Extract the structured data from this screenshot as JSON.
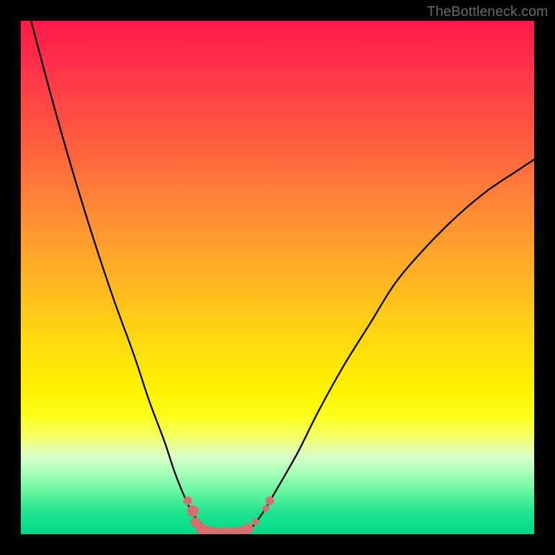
{
  "watermark": "TheBottleneck.com",
  "chart_data": {
    "type": "line",
    "title": "",
    "xlabel": "",
    "ylabel": "",
    "xlim": [
      0,
      100
    ],
    "ylim": [
      0,
      100
    ],
    "series": [
      {
        "name": "left-curve",
        "x": [
          2,
          6,
          10,
          14,
          18,
          22,
          25,
          28,
          30,
          32,
          33.5,
          35,
          36
        ],
        "values": [
          100,
          85,
          71,
          58,
          46,
          35,
          26,
          18,
          12,
          7,
          4,
          2,
          0
        ]
      },
      {
        "name": "right-curve",
        "x": [
          44,
          47,
          50,
          54,
          58,
          63,
          68,
          73,
          79,
          85,
          91,
          97,
          100
        ],
        "values": [
          0,
          4,
          9,
          16,
          24,
          33,
          41,
          49,
          56,
          62,
          67,
          71,
          73
        ]
      }
    ],
    "flat_bottom": {
      "x_start": 36,
      "x_end": 44,
      "value": 0
    },
    "markers": {
      "name": "bottom-dots",
      "color": "#d6706f",
      "points": [
        {
          "x": 32.5,
          "y": 6.5,
          "r": 1.5
        },
        {
          "x": 33.5,
          "y": 4.5,
          "r": 2.0
        },
        {
          "x": 34.0,
          "y": 2.3,
          "r": 1.7
        },
        {
          "x": 35.2,
          "y": 1.0,
          "r": 2.0
        },
        {
          "x": 36.8,
          "y": 0.4,
          "r": 2.0
        },
        {
          "x": 38.4,
          "y": 0.2,
          "r": 2.0
        },
        {
          "x": 40.0,
          "y": 0.2,
          "r": 2.0
        },
        {
          "x": 41.6,
          "y": 0.2,
          "r": 2.0
        },
        {
          "x": 43.0,
          "y": 0.4,
          "r": 2.0
        },
        {
          "x": 44.3,
          "y": 1.1,
          "r": 1.8
        },
        {
          "x": 45.7,
          "y": 2.4,
          "r": 1.2
        },
        {
          "x": 47.7,
          "y": 5.0,
          "r": 1.2
        },
        {
          "x": 48.5,
          "y": 6.5,
          "r": 1.5
        }
      ]
    },
    "gradient_stops": [
      {
        "pos": 0,
        "color": "#ff1a4a"
      },
      {
        "pos": 0.35,
        "color": "#ff8a35"
      },
      {
        "pos": 0.7,
        "color": "#fff200"
      },
      {
        "pos": 0.88,
        "color": "#a8ffb8"
      },
      {
        "pos": 1.0,
        "color": "#00d987"
      }
    ]
  }
}
